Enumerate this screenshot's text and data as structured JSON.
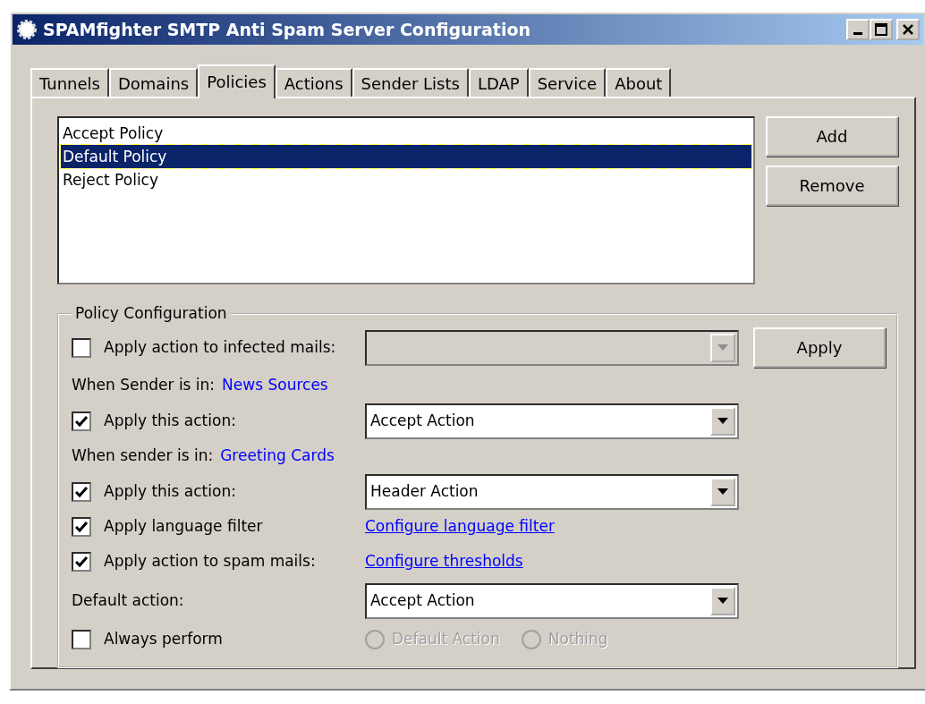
{
  "window": {
    "title": "SPAMfighter SMTP Anti Spam Server Configuration"
  },
  "tabs": [
    {
      "label": "Tunnels",
      "selected": false
    },
    {
      "label": "Domains",
      "selected": false
    },
    {
      "label": "Policies",
      "selected": true
    },
    {
      "label": "Actions",
      "selected": false
    },
    {
      "label": "Sender Lists",
      "selected": false
    },
    {
      "label": "LDAP",
      "selected": false
    },
    {
      "label": "Service",
      "selected": false
    },
    {
      "label": "About",
      "selected": false
    }
  ],
  "policies": [
    {
      "label": "Accept Policy",
      "selected": false
    },
    {
      "label": "Default Policy",
      "selected": true
    },
    {
      "label": "Reject Policy",
      "selected": false
    }
  ],
  "list_buttons": [
    "Add",
    "Remove"
  ],
  "policy_configuration": {
    "legend": "Policy Configuration",
    "apply_button": "Apply",
    "rows": [
      {
        "kind": "check_combo",
        "label": "Apply action to infected mails:",
        "checked": false,
        "disabled": true
      },
      {
        "kind": "sender",
        "label": "When Sender is in:",
        "link": "News Sources"
      },
      {
        "kind": "check_combo",
        "label": "Apply this action:",
        "checked": true,
        "disabled": false,
        "value": "Accept Action"
      },
      {
        "kind": "sender",
        "label": "When sender is in:",
        "link": "Greeting Cards"
      },
      {
        "kind": "check_combo",
        "label": "Apply this action:",
        "checked": true,
        "disabled": false,
        "value": "Header Action"
      },
      {
        "kind": "check_link",
        "label": "Apply language filter",
        "checked": true,
        "link": "Configure language filter"
      },
      {
        "kind": "check_link",
        "label": "Apply action to spam mails:",
        "checked": true,
        "link": "Configure thresholds"
      },
      {
        "kind": "label_combo",
        "label": "Default action:",
        "disabled": false,
        "value": "Accept Action"
      },
      {
        "kind": "check_radios",
        "label": "Always perform",
        "checked": false,
        "options": [
          {
            "label": "Default Action",
            "selected": false,
            "disabled": true
          },
          {
            "label": "Nothing",
            "selected": false,
            "disabled": true
          }
        ]
      }
    ]
  }
}
